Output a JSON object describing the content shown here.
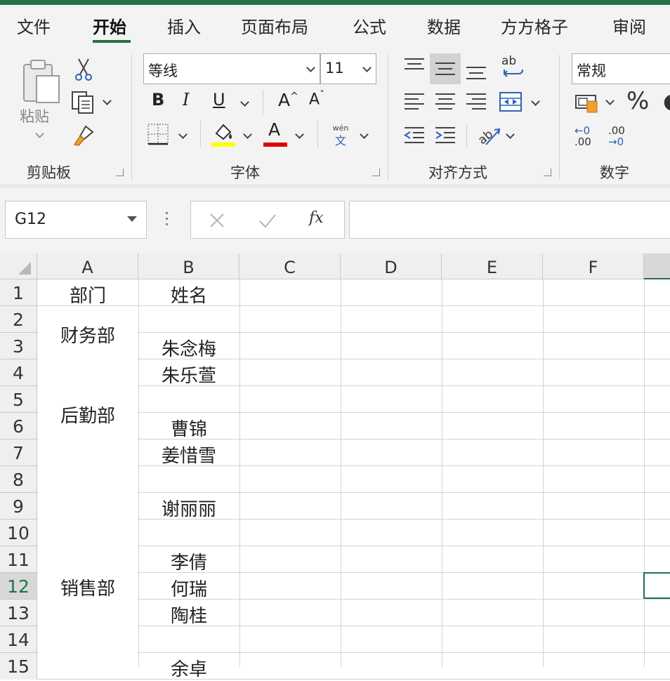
{
  "tabs": [
    {
      "label": "文件"
    },
    {
      "label": "开始"
    },
    {
      "label": "插入"
    },
    {
      "label": "页面布局"
    },
    {
      "label": "公式"
    },
    {
      "label": "数据"
    },
    {
      "label": "方方格子"
    },
    {
      "label": "审阅"
    }
  ],
  "ribbon": {
    "clipboard": {
      "paste_label": "粘贴",
      "group_label": "剪贴板"
    },
    "font": {
      "font_name": "等线",
      "font_size": "11",
      "bold": "B",
      "italic": "I",
      "underline": "U",
      "grow": "A",
      "shrink": "A",
      "color_a": "A",
      "phonetic_top": "wén",
      "phonetic_bottom": "文",
      "group_label": "字体",
      "highlight_color": "#FFFF00",
      "font_color": "#E00000"
    },
    "alignment": {
      "group_label": "对齐方式",
      "orient": "ab"
    },
    "number": {
      "format": "常规",
      "percent": "%",
      "group_label": "数字",
      "inc_top": "←0",
      "inc_bottom": ".00",
      "dec_top": ".00",
      "dec_bottom": "→0"
    }
  },
  "formula_bar": {
    "name_box": "G12",
    "fx": "fx",
    "value": ""
  },
  "columns": [
    "A",
    "B",
    "C",
    "D",
    "E",
    "F"
  ],
  "rows": [
    "1",
    "2",
    "3",
    "4",
    "5",
    "6",
    "7",
    "8",
    "9",
    "10",
    "11",
    "12",
    "13",
    "14",
    "15"
  ],
  "cells": {
    "A1": "部门",
    "B1": "姓名",
    "A2": "财务部",
    "B3": "朱念梅",
    "A4": "后勤部",
    "B4": "朱乐萱",
    "B6": "曹锦",
    "B7": "姜惜雪",
    "A8": "销售部",
    "B9": "谢丽丽",
    "B11": "李倩",
    "B12": "何瑞",
    "B13": "陶桂",
    "B15": "余卓"
  },
  "colors": {
    "accent": "#217346",
    "selected_cell_border": "#217346"
  }
}
